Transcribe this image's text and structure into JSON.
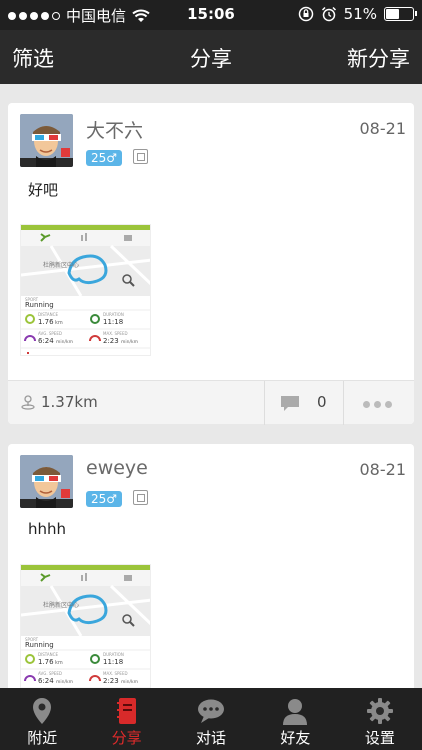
{
  "status": {
    "carrier": "中国电信",
    "time": "15:06",
    "battery": "51%",
    "battery_level": 0.51
  },
  "nav": {
    "left": "筛选",
    "title": "分享",
    "right": "新分享"
  },
  "posts": [
    {
      "username": "大不六",
      "date": "08-21",
      "badge": "25♂",
      "text": "好吧",
      "distance": "1.37km",
      "comments": "0"
    },
    {
      "username": "eweye",
      "date": "08-21",
      "badge": "25♂",
      "text": "hhhh"
    }
  ],
  "thumb": {
    "map_label": "杜鹃新区中心",
    "sport_label": "SPORT",
    "sport": "Running",
    "distance_label": "DISTANCE",
    "distance": "1.76",
    "distance_unit": "km",
    "duration_label": "DURATION",
    "duration": "11:18",
    "avg_label": "AVG. SPEED",
    "avg": "6:24",
    "avg_unit": "min/km",
    "max_label": "MAX. SPEED",
    "max": "2:23",
    "max_unit": "min/km"
  },
  "tabs": [
    {
      "label": "附近",
      "icon": "location-pin-icon",
      "color": "#ffffff"
    },
    {
      "label": "分享",
      "icon": "notebook-icon",
      "color": "#e02b2b"
    },
    {
      "label": "对话",
      "icon": "chat-bubble-icon",
      "color": "#ffffff"
    },
    {
      "label": "好友",
      "icon": "person-icon",
      "color": "#ffffff"
    },
    {
      "label": "设置",
      "icon": "gear-icon",
      "color": "#ffffff"
    }
  ]
}
